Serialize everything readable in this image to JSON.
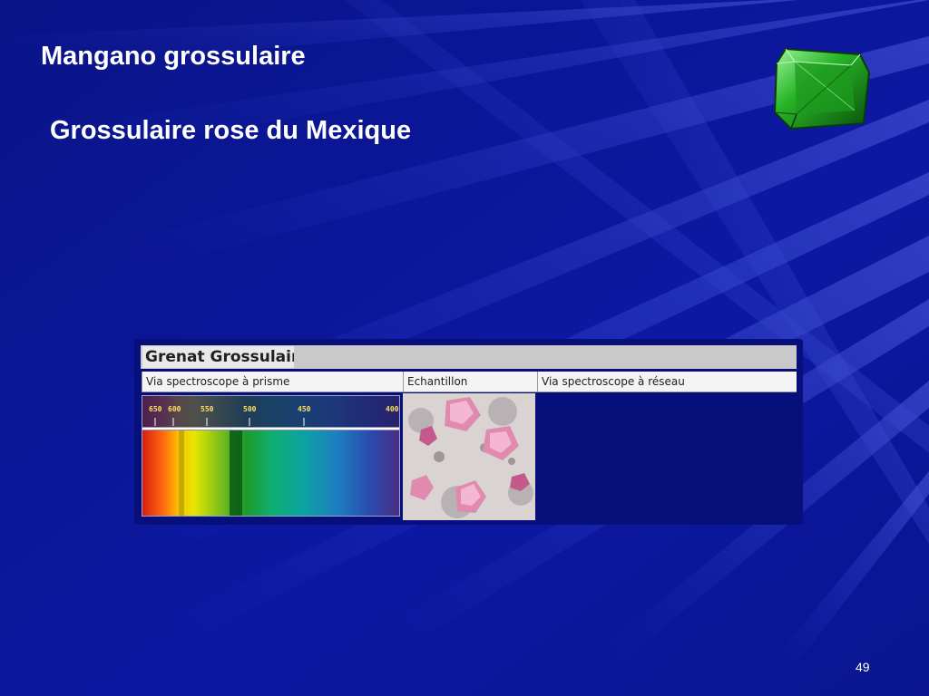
{
  "slide": {
    "title": "Mangano grossulaire",
    "subtitle": "Grossulaire rose du Mexique",
    "page_number": "49"
  },
  "figure": {
    "header": "Grenat Grossulaire",
    "columns": [
      "Via spectroscope à prisme",
      "Echantillon",
      "Via spectroscope à réseau"
    ],
    "scale_labels": [
      "650",
      "600",
      "550",
      "500",
      "450",
      "400"
    ]
  },
  "icons": {
    "gem": "green-gemstone-icon"
  },
  "colors": {
    "background": "#0b169a",
    "text": "#ffffff",
    "gem": "#2fbf2f"
  }
}
